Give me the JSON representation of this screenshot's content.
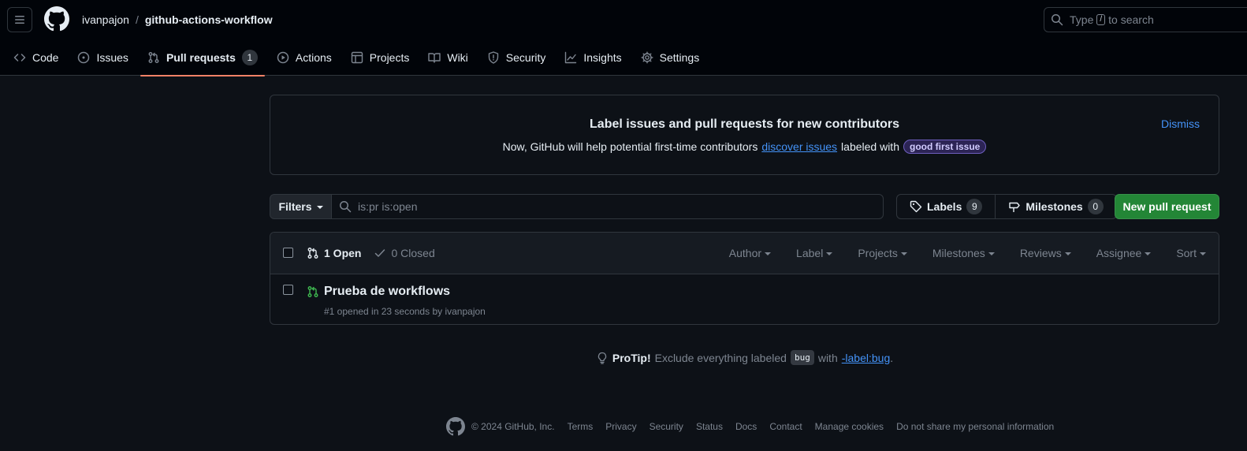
{
  "header": {
    "owner": "ivanpajon",
    "separator": "/",
    "repo": "github-actions-workflow",
    "search": {
      "prefix": "Type",
      "key": "/",
      "suffix": "to search"
    }
  },
  "tabs": [
    {
      "label": "Code",
      "icon": "code-icon"
    },
    {
      "label": "Issues",
      "icon": "issue-icon"
    },
    {
      "label": "Pull requests",
      "icon": "pull-request-icon",
      "count": "1",
      "active": true
    },
    {
      "label": "Actions",
      "icon": "play-icon"
    },
    {
      "label": "Projects",
      "icon": "table-icon"
    },
    {
      "label": "Wiki",
      "icon": "book-icon"
    },
    {
      "label": "Security",
      "icon": "shield-icon"
    },
    {
      "label": "Insights",
      "icon": "graph-icon"
    },
    {
      "label": "Settings",
      "icon": "gear-icon"
    }
  ],
  "banner": {
    "title": "Label issues and pull requests for new contributors",
    "text_before": "Now, GitHub will help potential first-time contributors",
    "link": "discover issues",
    "text_after": "labeled with",
    "label": "good first issue",
    "dismiss": "Dismiss"
  },
  "filter_bar": {
    "filters_label": "Filters",
    "query": "is:pr is:open",
    "labels_label": "Labels",
    "labels_count": "9",
    "milestones_label": "Milestones",
    "milestones_count": "0",
    "new_pr_label": "New pull request"
  },
  "pr_list": {
    "open_label": "1 Open",
    "closed_label": "0 Closed",
    "sorters": [
      "Author",
      "Label",
      "Projects",
      "Milestones",
      "Reviews",
      "Assignee",
      "Sort"
    ],
    "items": [
      {
        "title": "Prueba de workflows",
        "meta": "#1 opened in 23 seconds by ivanpajon",
        "status_color": "#3fb950"
      }
    ]
  },
  "protip": {
    "lead": "ProTip!",
    "text": "Exclude everything labeled",
    "code": "bug",
    "with": "with",
    "link": "-label:bug",
    "end": "."
  },
  "footer": {
    "copyright": "© 2024 GitHub, Inc.",
    "links": [
      "Terms",
      "Privacy",
      "Security",
      "Status",
      "Docs",
      "Contact",
      "Manage cookies",
      "Do not share my personal information"
    ]
  }
}
